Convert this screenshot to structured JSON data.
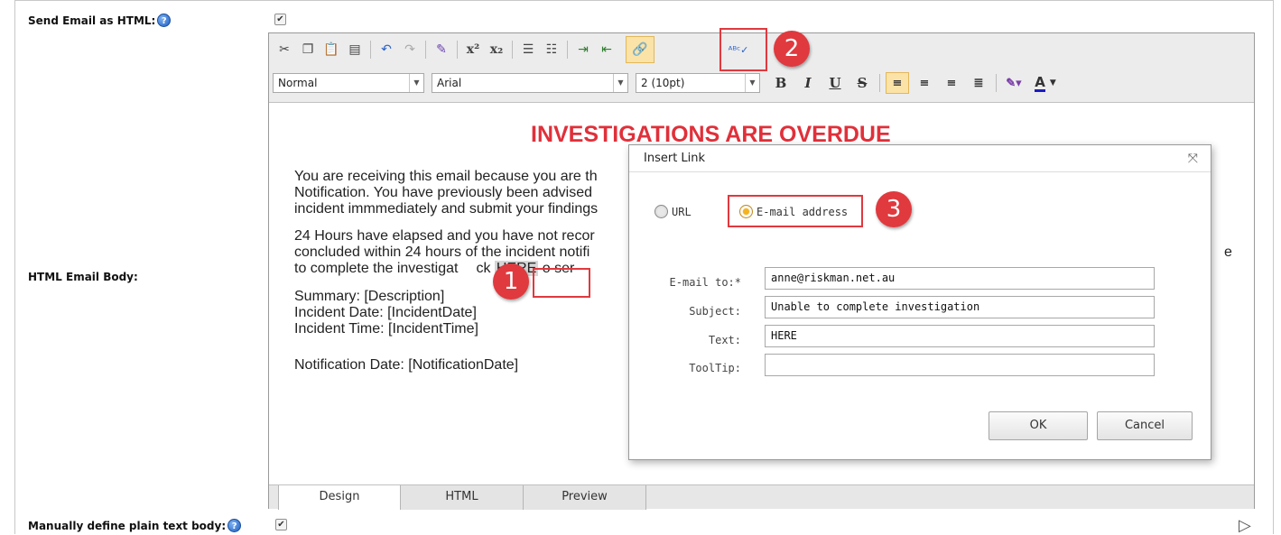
{
  "fields": {
    "send_html_label": "Send Email as HTML:",
    "send_html_checked": "✔",
    "body_label": "HTML Email Body:",
    "plain_text_label": "Manually define plain text body:",
    "plain_text_checked": "✔"
  },
  "toolbar": {
    "paragraph_format": "Normal",
    "font_name": "Arial",
    "font_size": "2 (10pt)",
    "bold": "B",
    "italic": "I",
    "underline": "U",
    "strike": "S",
    "font_color": "A"
  },
  "callouts": [
    "1",
    "2",
    "3"
  ],
  "content": {
    "heading": "INVESTIGATIONS ARE OVERDUE",
    "para1_line1": "You are receiving this email because you are th",
    "para1_line2": "Notification. You have previously been advised",
    "para1_line3": "incident immmediately and submit your findings",
    "para2_line1": "24 Hours have elapsed and you have not recor",
    "para2_line2": "concluded within 24 hours of the incident notifi",
    "para2_line2_tail": "e",
    "para2_line3_pre": "to complete the investigat",
    "para2_line3_mid": "ck",
    "here_link": "HERE",
    "para2_line3_post": "o ser",
    "summary": "Summary: [Description]",
    "incident_date": "Incident Date: [IncidentDate]",
    "incident_time": "Incident Time: [IncidentTime]",
    "notification_date": "Notification Date: [NotificationDate]"
  },
  "tabs": [
    "Design",
    "HTML",
    "Preview"
  ],
  "dialog": {
    "title": "Insert Link",
    "radio_url": "URL",
    "radio_email": "E-mail address",
    "email_to_label": "E-mail to:*",
    "email_to_value": "anne@riskman.net.au",
    "subject_label": "Subject:",
    "subject_value": "Unable to complete investigation",
    "text_label": "Text:",
    "text_value": "HERE",
    "tooltip_label": "ToolTip:",
    "tooltip_value": "",
    "ok": "OK",
    "cancel": "Cancel"
  },
  "icons": [
    "cut-icon",
    "copy-icon",
    "paste-icon",
    "paste-word-icon",
    "undo-icon",
    "redo-icon",
    "format-stripper-icon",
    "superscript-icon",
    "subscript-icon",
    "numbered-list-icon",
    "bullet-list-icon",
    "indent-icon",
    "outdent-icon",
    "link-manager-icon",
    "spellcheck-icon",
    "align-left-icon",
    "align-center-icon",
    "align-right-icon",
    "justify-icon",
    "highlight-icon",
    "font-color-icon",
    "help-icon",
    "close-icon"
  ]
}
